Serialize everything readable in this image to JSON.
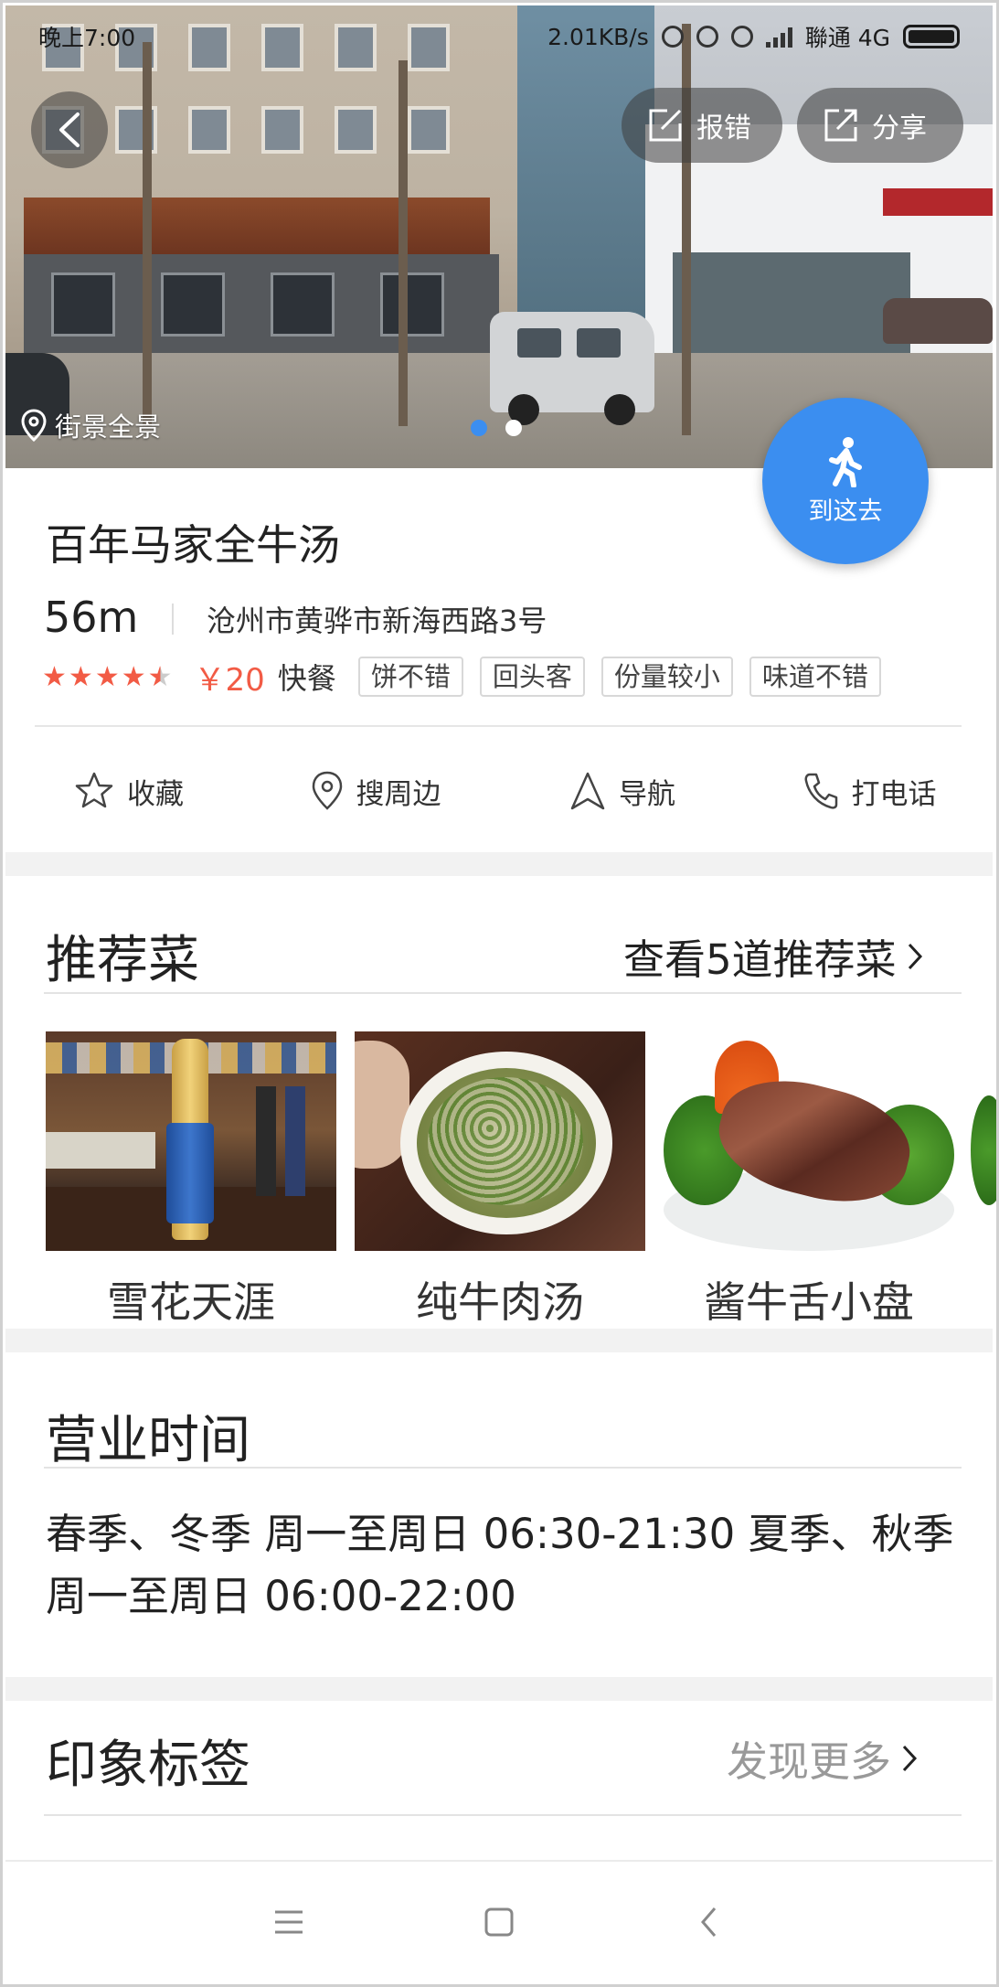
{
  "status_bar": {
    "time": "晚上7:00",
    "net_speed": "2.01KB/s",
    "carrier": "聯通 4G"
  },
  "header": {
    "report_label": "报错",
    "share_label": "分享"
  },
  "hero": {
    "street_view_label": "街景全景",
    "page_count": 2,
    "active_page": 1
  },
  "go_button": {
    "label": "到这去"
  },
  "poi": {
    "name": "百年马家全牛汤",
    "distance": "56m",
    "address": "沧州市黄骅市新海西路3号",
    "rating": 4.5,
    "price": "￥20",
    "category": "快餐",
    "tags": [
      "饼不错",
      "回头客",
      "份量较小",
      "味道不错"
    ]
  },
  "actions": [
    {
      "label": "收藏",
      "icon": "star-icon"
    },
    {
      "label": "搜周边",
      "icon": "location-pin-icon"
    },
    {
      "label": "导航",
      "icon": "navigation-arrow-icon"
    },
    {
      "label": "打电话",
      "icon": "phone-icon"
    }
  ],
  "recommended": {
    "title": "推荐菜",
    "link": "查看5道推荐菜",
    "dishes": [
      {
        "name": "雪花天涯"
      },
      {
        "name": "纯牛肉汤"
      },
      {
        "name": "酱牛舌小盘"
      }
    ]
  },
  "hours": {
    "title": "营业时间",
    "text": "春季、冬季 周一至周日 06:30-21:30 夏季、秋季 周一至周日 06:00-22:00"
  },
  "impression": {
    "title": "印象标签",
    "link": "发现更多"
  },
  "colors": {
    "accent": "#3b8ef0",
    "price": "#f25b45",
    "muted_link": "#999999"
  }
}
